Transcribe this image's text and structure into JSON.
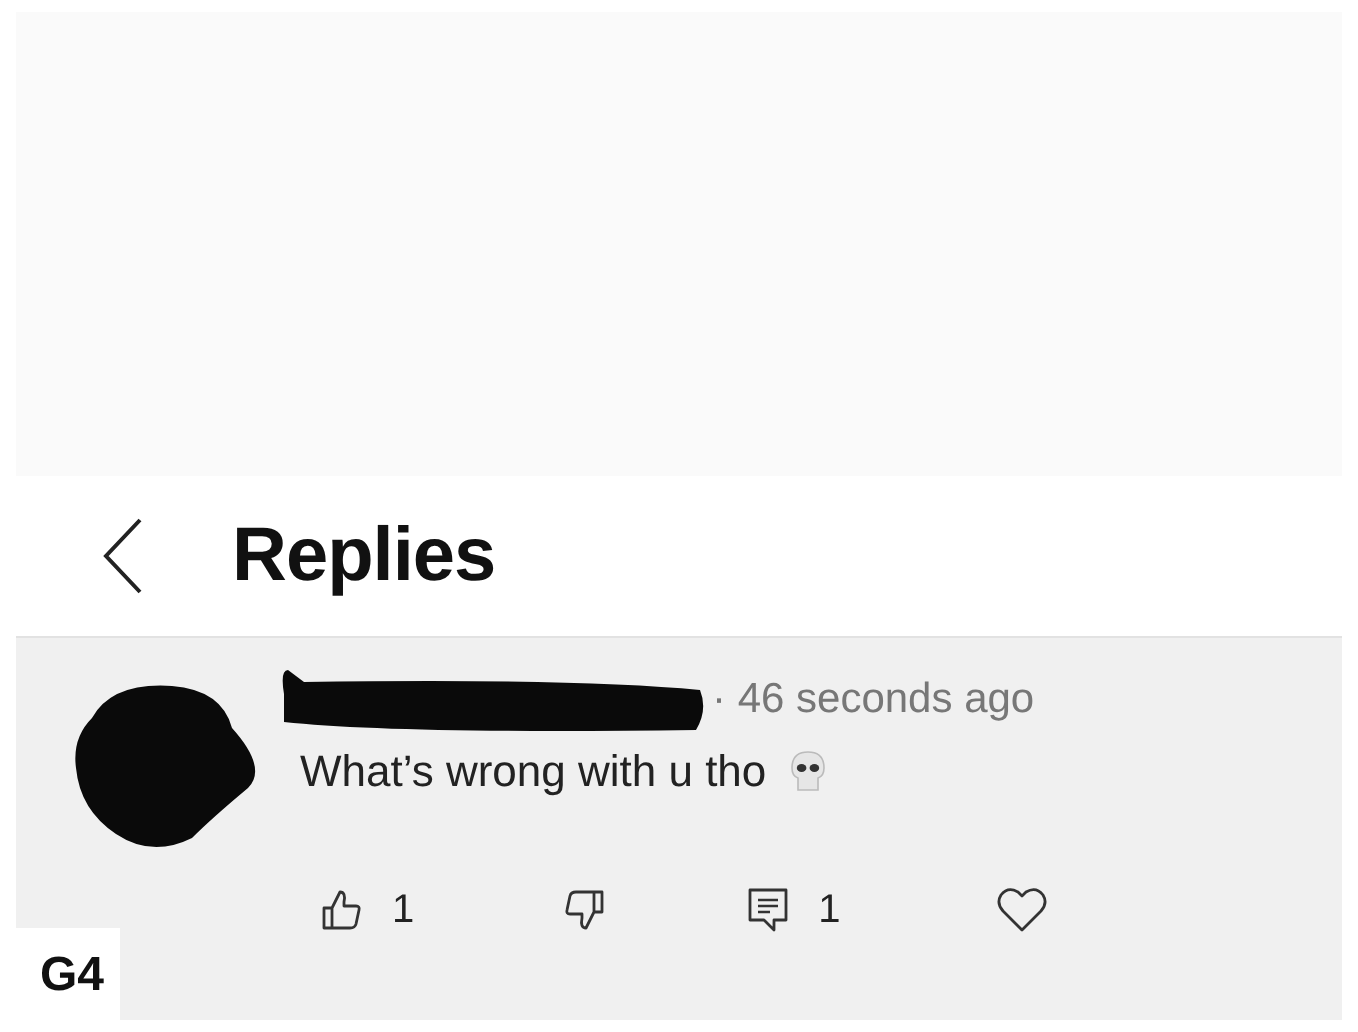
{
  "header": {
    "title": "Replies"
  },
  "comment": {
    "time": "· 46 seconds ago",
    "text": "What’s wrong with u tho",
    "likes": "1",
    "replies": "1"
  },
  "corner_label": "G4"
}
